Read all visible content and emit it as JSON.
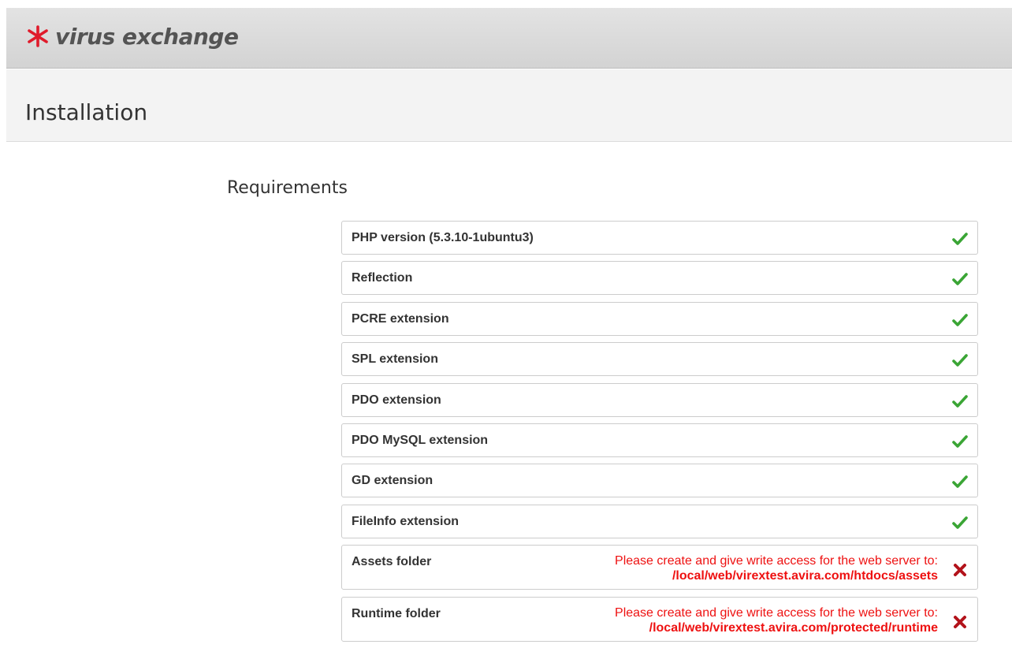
{
  "header": {
    "brand_text": "virus exchange",
    "brand_icon": "asterisk-logo-icon",
    "brand_color": "#e01b2b"
  },
  "page": {
    "title": "Installation"
  },
  "requirements": {
    "title": "Requirements",
    "items": [
      {
        "label": "PHP version (5.3.10-1ubuntu3)",
        "status": "ok"
      },
      {
        "label": "Reflection",
        "status": "ok"
      },
      {
        "label": "PCRE extension",
        "status": "ok"
      },
      {
        "label": "SPL extension",
        "status": "ok"
      },
      {
        "label": "PDO extension",
        "status": "ok"
      },
      {
        "label": "PDO MySQL extension",
        "status": "ok"
      },
      {
        "label": "GD extension",
        "status": "ok"
      },
      {
        "label": "FileInfo extension",
        "status": "ok"
      },
      {
        "label": "Assets folder",
        "status": "error",
        "message": "Please create and give write access for the web server to:",
        "path": "/local/web/virextest.avira.com/htdocs/assets"
      },
      {
        "label": "Runtime folder",
        "status": "error",
        "message": "Please create and give write access for the web server to:",
        "path": "/local/web/virextest.avira.com/protected/runtime"
      }
    ]
  },
  "colors": {
    "ok": "#3aa535",
    "error": "#b3131b",
    "error_text": "#ee1111"
  }
}
